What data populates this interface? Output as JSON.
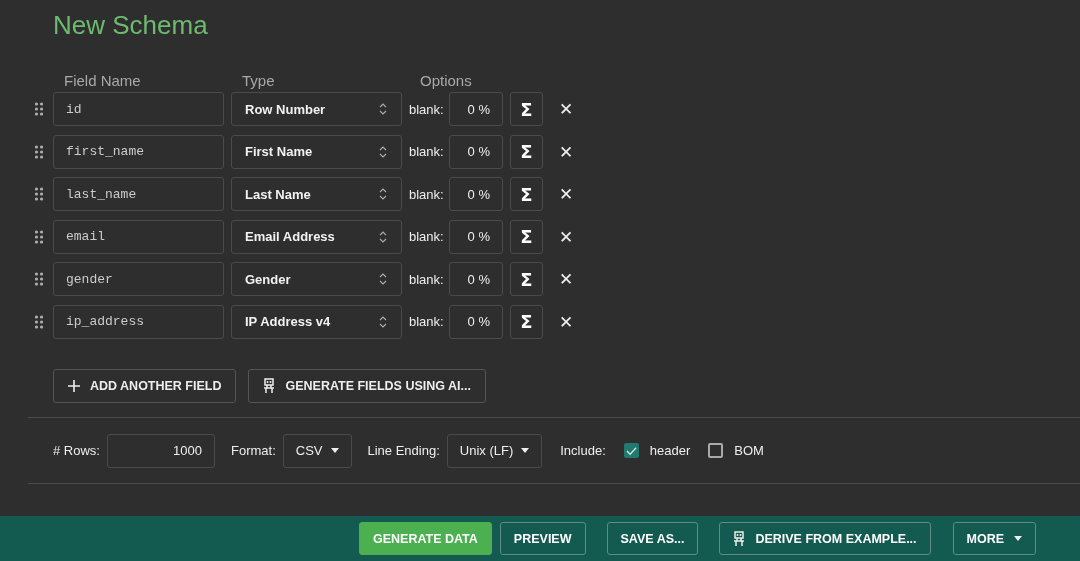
{
  "title": "New Schema",
  "columns": [
    "Field Name",
    "Type",
    "Options"
  ],
  "fields": [
    {
      "name": "id",
      "type": "Row Number",
      "blank_label": "blank:",
      "blank": "0 %",
      "sigma": "Σ",
      "remove": "✕"
    },
    {
      "name": "first_name",
      "type": "First Name",
      "blank_label": "blank:",
      "blank": "0 %",
      "sigma": "Σ",
      "remove": "✕"
    },
    {
      "name": "last_name",
      "type": "Last Name",
      "blank_label": "blank:",
      "blank": "0 %",
      "sigma": "Σ",
      "remove": "✕"
    },
    {
      "name": "email",
      "type": "Email Address",
      "blank_label": "blank:",
      "blank": "0 %",
      "sigma": "Σ",
      "remove": "✕"
    },
    {
      "name": "gender",
      "type": "Gender",
      "blank_label": "blank:",
      "blank": "0 %",
      "sigma": "Σ",
      "remove": "✕"
    },
    {
      "name": "ip_address",
      "type": "IP Address v4",
      "blank_label": "blank:",
      "blank": "0 %",
      "sigma": "Σ",
      "remove": "✕"
    }
  ],
  "field_buttons": [
    {
      "kind": "add",
      "label": "ADD ANOTHER FIELD"
    },
    {
      "kind": "ai",
      "label": "GENERATE FIELDS USING AI..."
    }
  ],
  "options": {
    "rows_label": "# Rows:",
    "rows": "1000",
    "format_label": "Format:",
    "format": "CSV",
    "line_ending_label": "Line Ending:",
    "line_ending": "Unix (LF)",
    "include_label": "Include:",
    "include": [
      {
        "label": "header",
        "checked": true
      },
      {
        "label": "BOM",
        "checked": false
      }
    ]
  },
  "actions": [
    {
      "kind": "primary",
      "label": "GENERATE DATA"
    },
    {
      "kind": "plain",
      "label": "PREVIEW"
    },
    {
      "kind": "plain",
      "label": "SAVE AS..."
    },
    {
      "kind": "robot",
      "label": "DERIVE FROM EXAMPLE..."
    },
    {
      "kind": "menu",
      "label": "MORE"
    }
  ]
}
